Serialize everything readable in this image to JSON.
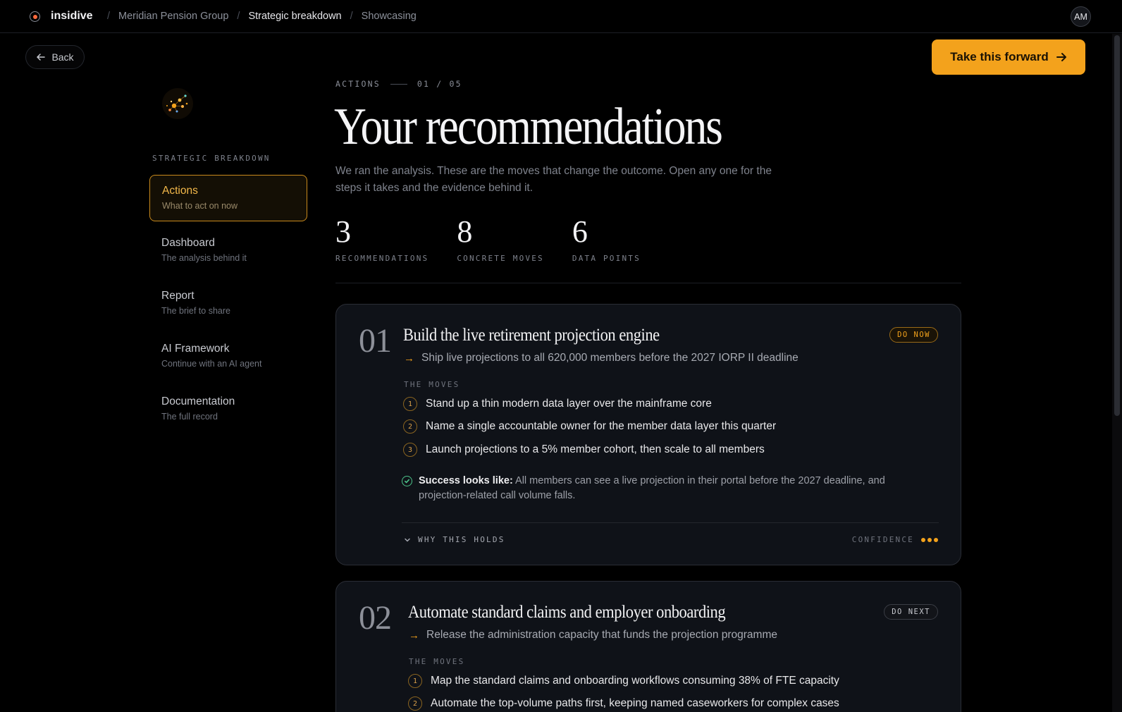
{
  "topbar": {
    "brand": "insidive",
    "breadcrumbs": [
      "Meridian Pension Group",
      "Strategic breakdown",
      "Showcasing"
    ],
    "avatar_initials": "AM"
  },
  "back_label": "Back",
  "cta_label": "Take this forward",
  "sidebar": {
    "section_label": "STRATEGIC BREAKDOWN",
    "items": [
      {
        "title": "Actions",
        "subtitle": "What to act on now"
      },
      {
        "title": "Dashboard",
        "subtitle": "The analysis behind it"
      },
      {
        "title": "Report",
        "subtitle": "The brief to share"
      },
      {
        "title": "AI Framework",
        "subtitle": "Continue with an AI agent"
      },
      {
        "title": "Documentation",
        "subtitle": "The full record"
      }
    ]
  },
  "header": {
    "eyebrow": "ACTIONS",
    "pager": "01 / 05",
    "title": "Your recommendations",
    "lede": "We ran the analysis. These are the moves that change the outcome. Open any one for the steps it takes and the evidence behind it."
  },
  "stats": [
    {
      "value": "3",
      "label": "RECOMMENDATIONS"
    },
    {
      "value": "8",
      "label": "CONCRETE MOVES"
    },
    {
      "value": "6",
      "label": "DATA POINTS"
    }
  ],
  "cards": [
    {
      "number": "01",
      "title": "Build the live retirement projection engine",
      "subtitle": "Ship live projections to all 620,000 members before the 2027 IORP II deadline",
      "badge": "DO NOW",
      "moves_label": "THE MOVES",
      "moves": [
        "Stand up a thin modern data layer over the mainframe core",
        "Name a single accountable owner for the member data layer this quarter",
        "Launch projections to a 5% member cohort, then scale to all members"
      ],
      "success_label": "Success looks like:",
      "success_text": "All members can see a live projection in their portal before the 2027 deadline, and projection-related call volume falls.",
      "why_label": "WHY THIS HOLDS",
      "confidence_label": "CONFIDENCE",
      "confidence_level": 3
    },
    {
      "number": "02",
      "title": "Automate standard claims and employer onboarding",
      "subtitle": "Release the administration capacity that funds the projection programme",
      "badge": "DO NEXT",
      "moves_label": "THE MOVES",
      "moves": [
        "Map the standard claims and onboarding workflows consuming 38% of FTE capacity",
        "Automate the top-volume paths first, keeping named caseworkers for complex cases"
      ]
    }
  ],
  "colors": {
    "accent": "#f3a21c",
    "success": "#4cc38a",
    "background": "#000000",
    "card": "#0f1218"
  }
}
